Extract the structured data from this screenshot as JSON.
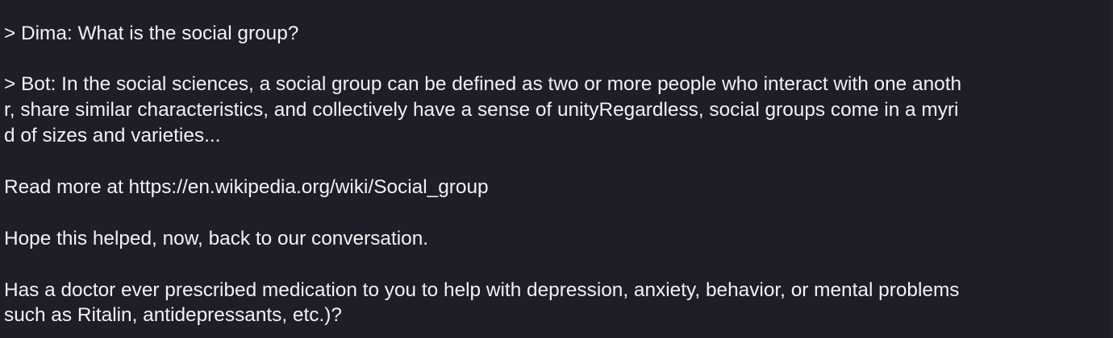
{
  "transcript": {
    "lines": [
      "> Dima: What is the social group?",
      "> Bot: In the social sciences, a social group can be defined as two or more people who interact with one anoth",
      "r, share similar characteristics, and collectively have a sense of unityRegardless, social groups come in a myri",
      "d of sizes and varieties...",
      "Read more at https://en.wikipedia.org/wiki/Social_group",
      "Hope this helped, now, back to our conversation.",
      "Has a doctor ever prescribed medication to you to help with depression, anxiety, behavior, or mental problems",
      "such as Ritalin, antidepressants, etc.)?"
    ]
  },
  "colors": {
    "background": "#1e1e28",
    "text": "#f2f2f2"
  }
}
